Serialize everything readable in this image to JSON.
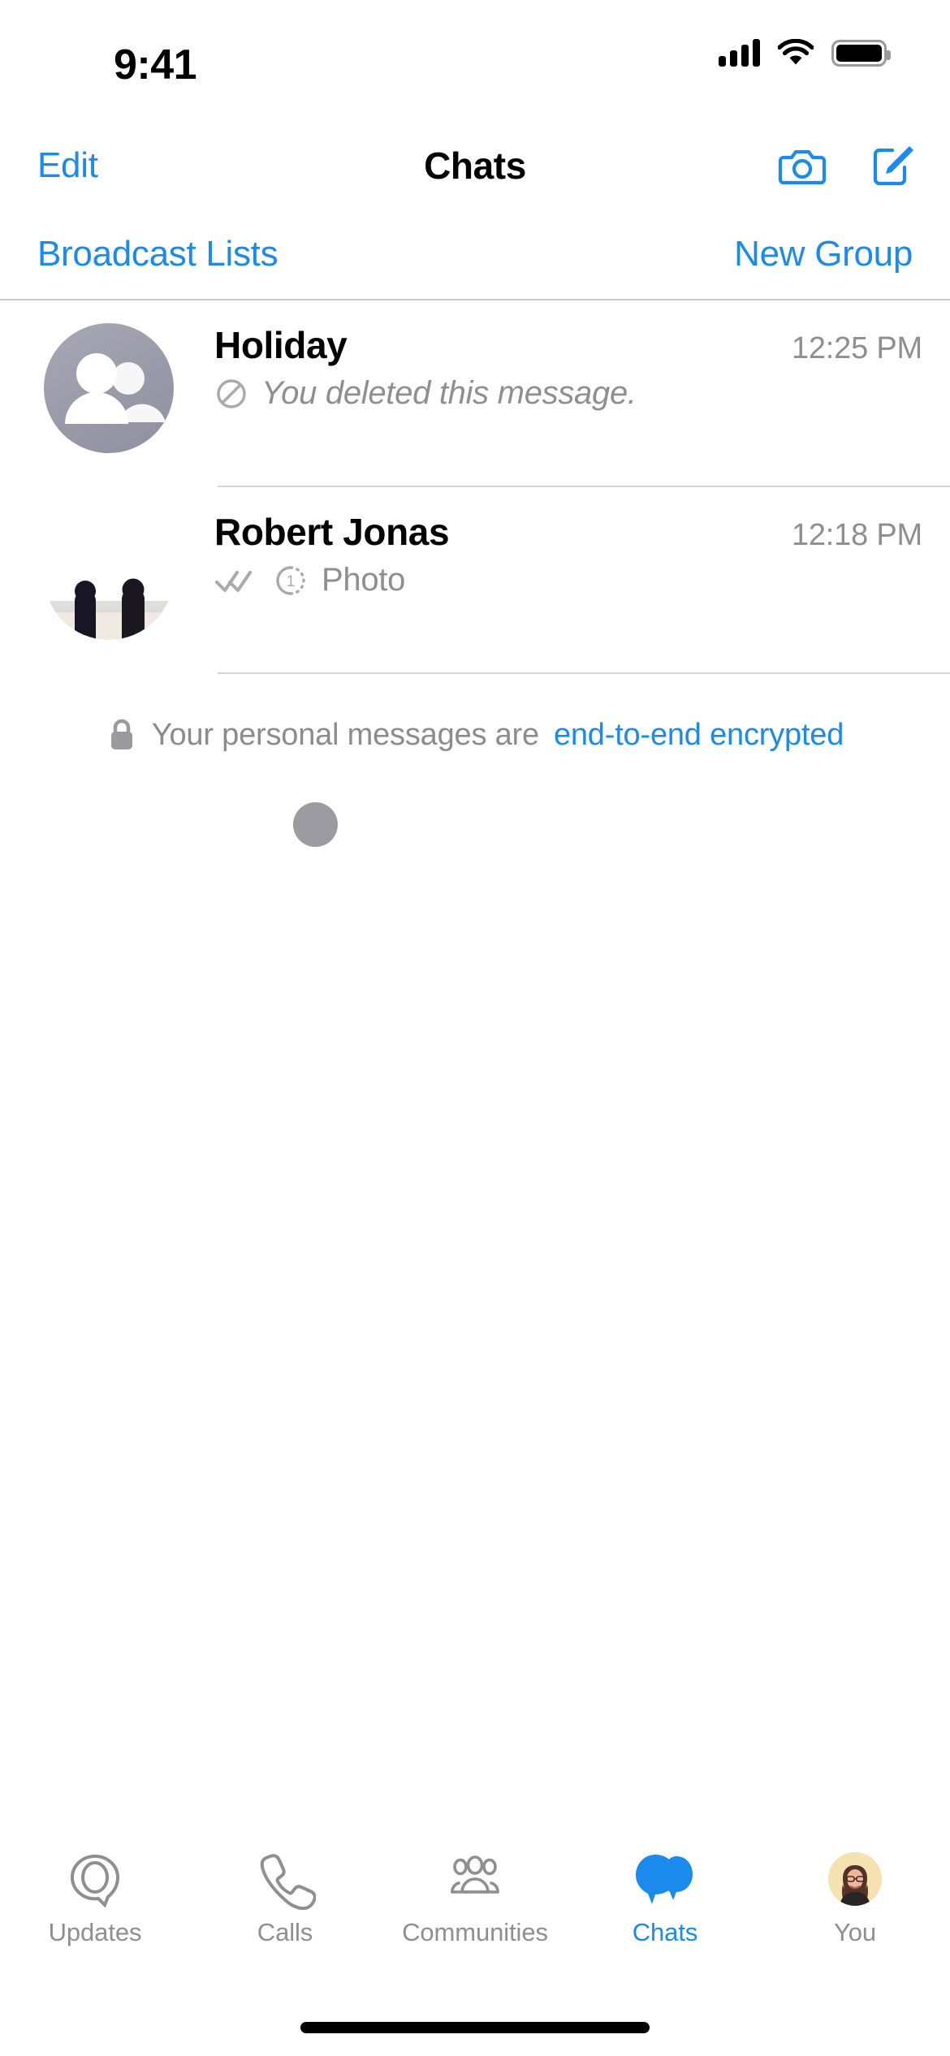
{
  "status_bar": {
    "time": "9:41",
    "signal_icon": "cellular-signal-icon",
    "wifi_icon": "wifi-icon",
    "battery_icon": "battery-full-icon"
  },
  "nav_bar": {
    "edit_label": "Edit",
    "title": "Chats",
    "camera_icon": "camera-icon",
    "compose_icon": "compose-new-chat-icon"
  },
  "sub_row": {
    "broadcast_lists_label": "Broadcast Lists",
    "new_group_label": "New Group"
  },
  "chats": [
    {
      "name": "Holiday",
      "time": "12:25 PM",
      "preview": "You deleted this message.",
      "status_icon": "deleted-message-icon",
      "avatar_type": "group-default-avatar",
      "italic": true
    },
    {
      "name": "Robert Jonas",
      "time": "12:18 PM",
      "preview": "Photo",
      "status_icon": "read-receipt-double-check-icon",
      "media_icon": "view-once-icon",
      "view_once_count": "1",
      "avatar_type": "beach-sunset-photo-avatar",
      "italic": false
    }
  ],
  "encryption_notice": {
    "lock_icon": "lock-icon",
    "text": "Your personal messages are",
    "link_text": "end-to-end encrypted"
  },
  "tab_bar": {
    "tabs": [
      {
        "label": "Updates",
        "icon": "updates-status-icon",
        "active": false
      },
      {
        "label": "Calls",
        "icon": "phone-icon",
        "active": false
      },
      {
        "label": "Communities",
        "icon": "communities-icon",
        "active": false
      },
      {
        "label": "Chats",
        "icon": "chat-bubbles-icon",
        "active": true
      },
      {
        "label": "You",
        "icon": "profile-avatar-icon",
        "active": false
      }
    ]
  },
  "colors": {
    "accent_blue": "#1b8aed",
    "secondary_text": "#8e8e93",
    "separator": "#d8d6da",
    "header_separator": "#c9c6cf"
  },
  "home_indicator": "home-indicator-bar"
}
